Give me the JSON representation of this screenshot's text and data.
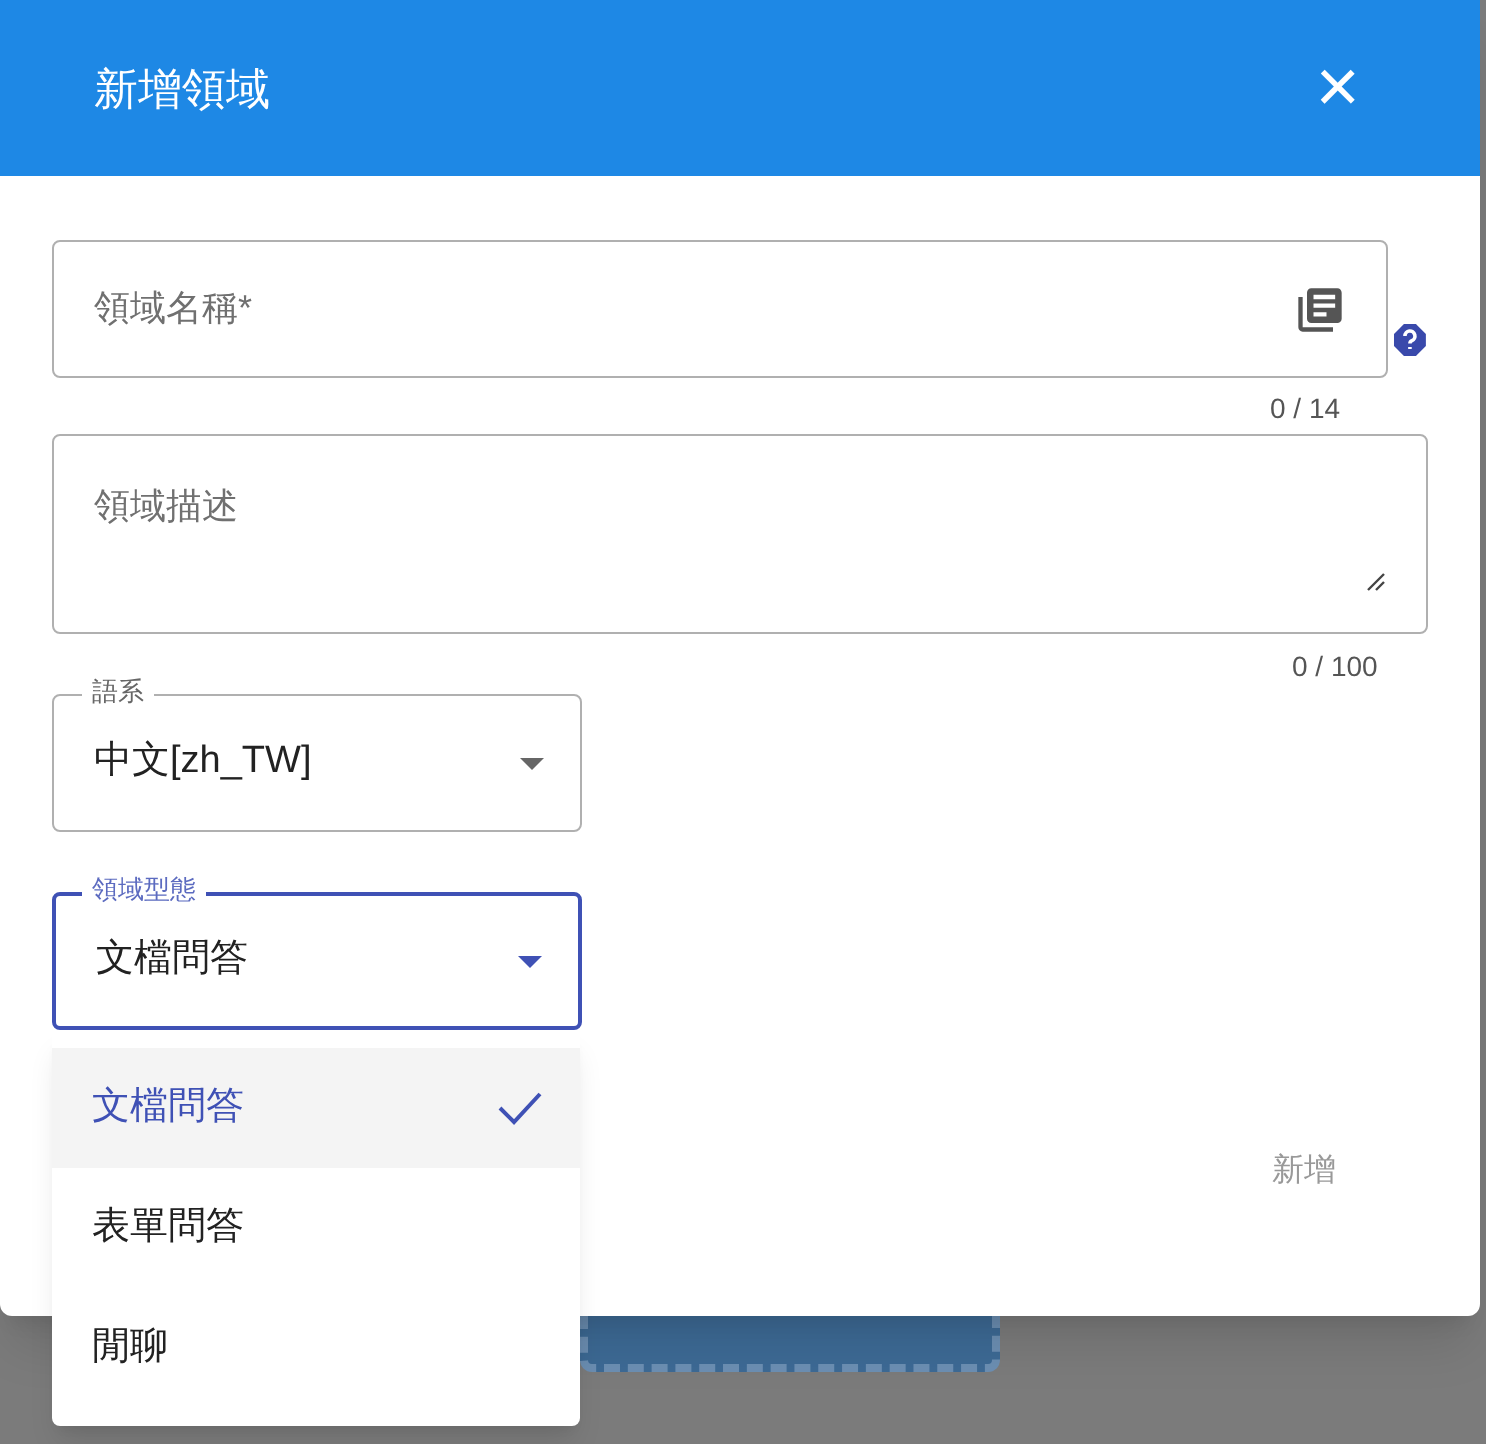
{
  "dialog": {
    "title": "新增領域",
    "close": "×"
  },
  "fields": [
    {
      "kind": "text",
      "placeholder": "領域名稱*",
      "counter": "0 / 14"
    },
    {
      "kind": "textarea",
      "placeholder": "領域描述",
      "counter": "0 / 100"
    }
  ],
  "selects": [
    {
      "label": "語系",
      "value": "中文[zh_TW]",
      "focused": false
    },
    {
      "label": "領域型態",
      "value": "文檔問答",
      "focused": true
    }
  ],
  "menu": [
    {
      "label": "文檔問答",
      "selected": true
    },
    {
      "label": "表單問答",
      "selected": false
    },
    {
      "label": "閒聊",
      "selected": false
    }
  ],
  "submit": {
    "label": "新增",
    "disabled": true
  }
}
